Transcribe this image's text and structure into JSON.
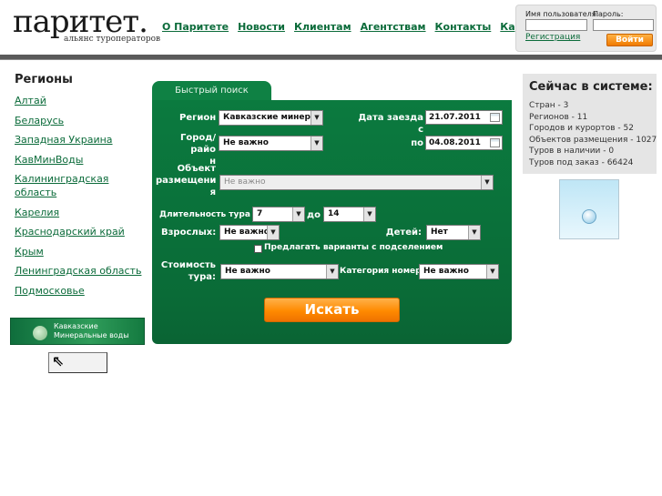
{
  "header": {
    "logo_main": "паритет.",
    "logo_sub": "альянс туроператоров",
    "nav": [
      "О Паритете",
      "Новости",
      "Клиентам",
      "Агентствам",
      "Контакты",
      "Карта сайта"
    ]
  },
  "login": {
    "username_label": "Имя пользователя:",
    "password_label": "Пароль:",
    "username_value": "",
    "password_value": "",
    "register_link": "Регистрация",
    "submit_label": "Войти"
  },
  "sidebar": {
    "title": "Регионы",
    "regions": [
      "Алтай",
      "Беларусь",
      "Западная Украина",
      "КавМинВоды",
      "Калининградская область",
      "Карелия",
      "Краснодарский край",
      "Крым",
      "Ленинградская область",
      "Подмосковье"
    ],
    "banner_text": "Кавказские\nМинеральные воды",
    "nav_arrow": "⇖"
  },
  "search": {
    "tab_label": "Быстрый поиск",
    "region_label": "Регион",
    "region_value": "Кавказские минерал",
    "arrival_label": "Дата заезда с",
    "arrival_value": "21.07.2011",
    "city_label": "Город/райо\nн",
    "city_value": "Не важно",
    "till_label": "по",
    "till_value": "04.08.2011",
    "object_label": "Объект\nразмещени\nя",
    "object_value": "Не важно",
    "duration_label": "Длительность тура от",
    "duration_from": "7",
    "duration_to_label": "до",
    "duration_to": "14",
    "adults_label": "Взрослых:",
    "adults_value": "Не важно",
    "children_label": "Детей:",
    "children_value": "Нет",
    "share_label": "Предлагать варианты с подселением",
    "share_checked": false,
    "cost_label": "Стоимость\nтура:",
    "cost_value": "Не важно",
    "room_label": "Категория номера:",
    "room_value": "Не важно",
    "submit_label": "Искать"
  },
  "stats": {
    "title": "Сейчас в системе:",
    "items": [
      "Стран - 3",
      "Регионов - 11",
      "Городов и курортов - 52",
      "Объектов размещения - 1027",
      "Туров в наличии - 0",
      "Туров под заказ - 66424"
    ]
  }
}
